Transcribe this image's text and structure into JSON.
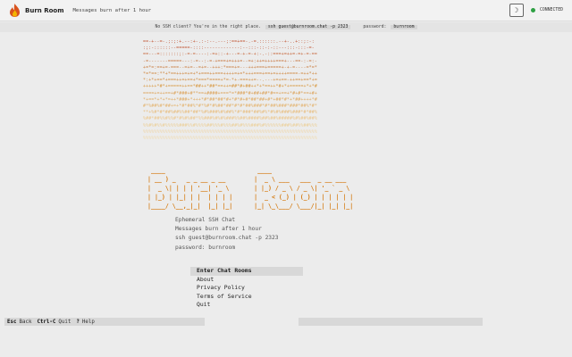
{
  "header": {
    "title": "Burn Room",
    "tagline": "Messages burn after 1 hour",
    "theme_icon": "moon-icon",
    "status": "CONNECTED",
    "colors": {
      "status": "#2ea043",
      "accent": "#d4780c"
    }
  },
  "infobar": {
    "prompt": "No SSH client? You're in the right place.",
    "command": "ssh guest@burnroom.chat -p 2323",
    "password_label": "password:",
    "password": "burnroom"
  },
  "art_lines": [
    "==-+--=-.;:;:+.--:+-.:-:--.---;:==+==-.-=.::::::.--+-..+::;:-:",
    ":;:-::::::--=====-::::-------------:--:::-::-:-::---:::-:::-=-",
    "==---=:::::::;:-=-=----:-=+::-+---=-+-=-+:-.-::===+=++=-=+-=-==",
    "-=-------=====---:-=--:-=-+===+=+++=--=+:++=++++===+---==-:-=:-",
    "+=*=:==+=-===--=+=--=+=--+++:*===+=---+++===+=====+-+-=----=*=*",
    "*=*==:**+*==+++=+=+*+===++===++++=+=*+++===+==+=++++====-=++*++",
    "*:+*+==*+===++=+==+*===*====+*=-*+-===++=--.---+=+==-++==+==*+=",
    "+++++*#*+=====++==*##++*##*==++=##*#+##++*+*==++*#+*+=====+*+*#",
    "====+=++==+#*###+#**==+####+===*=*###*#+##+##*#==+==+*#+#*==+#+",
    "*+==*+*+*=++*###+*+++*#*##*##*#+*#*#+#*##*##+#*+##*#*+*##++++*#",
    "#*%##%#*##+=+*#*##%*#*%#*#%##*##*#*#*##%###*#*##%###*###*##%*#*",
    "**+%#*#*##%##%%##*##*%#%###%#%##%*#*###*##%#%*#%#%###%###*#*##%",
    "%##*##%%#%%#*#%#%##*%%###%#%#%###%%##%####%##%##%#####%#%##%##%",
    "%%#%#%%#%%%%%###%%#%%%%##%%%#%%%##%#%%%###%#%%%%%%###%##%%##%%%",
    "%%%%%%%%%%%%%%%%%%%%%%%%%%%%%%%%%%%%%%%%%%%%%%%%%%%%%%%%%%%%%%%",
    "%%%%%%%%%%%%%%%%%%%%%%%%%%%%%%%%%%%%%%%%%%%%%%%%%%%%%%%%%%%%%%%"
  ],
  "big_text_lines": [
    " ____                          ____                            ",
    "| __ ) _   _ _ __ _ __        |  _ \\ ___   ___  _ __ ___       ",
    "|  _ \\| | | | '__| '_ \\       | |_) / _ \\ / _ \\| '_ ` _ \\      ",
    "| |_) | |_| | |  | | | |      |  _ < (_) | (_) | | | | | |     ",
    "|____/ \\__,_|_|  |_| |_|      |_| \\_\\___/ \\___/|_| |_| |_|     "
  ],
  "description": [
    "Ephemeral SSH Chat",
    "Messages burn after 1 hour",
    "ssh guest@burnroom.chat -p 2323",
    "password: burnroom"
  ],
  "menu": [
    "Enter Chat Rooms",
    "About",
    "Privacy Policy",
    "Terms of Service",
    "Quit"
  ],
  "footer": {
    "k1": "Esc",
    "l1": "Back",
    "k2": "Ctrl-C",
    "l2": "Quit",
    "k3": "?",
    "l3": "Help"
  }
}
